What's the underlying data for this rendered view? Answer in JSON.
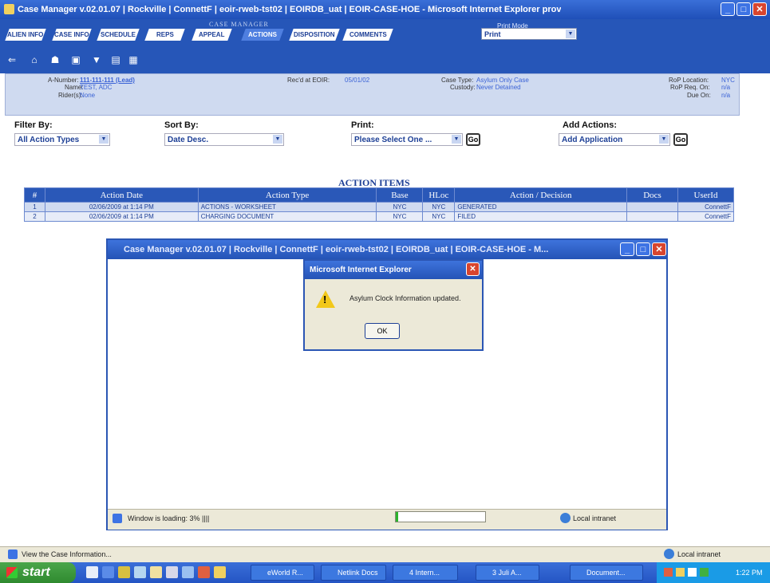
{
  "window": {
    "title": "Case Manager v.02.01.07 | Rockville | ConnettF | eoir-rweb-tst02 | EOIRDB_uat | EOIR-CASE-HOE - Microsoft Internet Explorer prov"
  },
  "app": {
    "name": "CASE MANAGER",
    "print_mode": "Print Mode",
    "tabs": [
      "ALIEN INFO",
      "CASE INFO",
      "SCHEDULE",
      "REPS",
      "APPEAL",
      "ACTIONS",
      "DISPOSITION",
      "COMMENTS"
    ],
    "active_tab": "ACTIONS",
    "print_select": "Print"
  },
  "info": {
    "a_number_label": "A-Number:",
    "a_number": "111-111-111 (Lead)",
    "name_label": "Name:",
    "name": "TEST, ADC",
    "riders_label": "Rider(s):",
    "riders": "None",
    "recd_label": "Rec'd at EOIR:",
    "recd": "05/01/02",
    "case_type_label": "Case Type:",
    "case_type": "Asylum Only Case",
    "custody_label": "Custody:",
    "custody": "Never Detained",
    "rop_location_label": "RoP Location:",
    "rop_location": "NYC",
    "rop_req_label": "RoP Req. On:",
    "rop_req": "n/a",
    "due_label": "Due On:",
    "due": "n/a"
  },
  "controls": {
    "filter_label": "Filter By:",
    "filter_value": "All Action Types",
    "sort_label": "Sort By:",
    "sort_value": "Date Desc.",
    "print_label": "Print:",
    "print_value": "Please Select One ...",
    "add_label": "Add Actions:",
    "add_value": "Add Application",
    "go_label": "Go"
  },
  "action_items": {
    "title": "ACTION ITEMS",
    "headers": [
      "#",
      "Action Date",
      "Action Type",
      "Base",
      "HLoc",
      "Action / Decision",
      "Docs",
      "UserId"
    ],
    "rows": [
      [
        "1",
        "02/06/2009 at 1:14 PM",
        "ACTIONS - WORKSHEET",
        "NYC",
        "NYC",
        "GENERATED",
        "",
        "ConnettF"
      ],
      [
        "2",
        "02/06/2009 at 1:14 PM",
        "CHARGING DOCUMENT",
        "NYC",
        "NYC",
        "FILED",
        "",
        "ConnettF"
      ]
    ]
  },
  "child_window": {
    "title": "Case Manager v.02.01.07 | Rockville | ConnettF | eoir-rweb-tst02 | EOIRDB_uat | EOIR-CASE-HOE - M...",
    "status": "Window is loading: 3% ||||",
    "zone": "Local intranet",
    "progress": 0.03
  },
  "dialog": {
    "title": "Microsoft Internet Explorer",
    "message": "Asylum Clock Information updated.",
    "ok": "OK"
  },
  "status_bar": {
    "text": "View the Case Information...",
    "zone": "Local intranet"
  },
  "taskbar": {
    "start": "start",
    "tasks": [
      "eWorld R...",
      "Netlink Docs",
      "4 Intern...",
      "3 Juli A...",
      "Document..."
    ],
    "clock": "1:22 PM"
  }
}
